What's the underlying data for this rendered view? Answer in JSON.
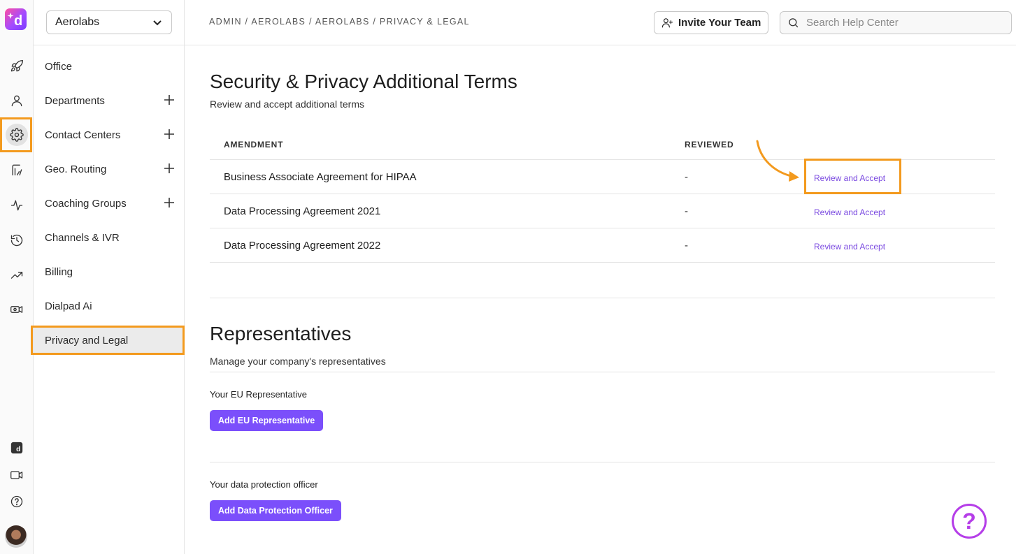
{
  "org_select": {
    "value": "Aerolabs"
  },
  "sidebar": {
    "items": [
      {
        "label": "Office",
        "has_plus": false
      },
      {
        "label": "Departments",
        "has_plus": true
      },
      {
        "label": "Contact Centers",
        "has_plus": true
      },
      {
        "label": "Geo. Routing",
        "has_plus": true
      },
      {
        "label": "Coaching Groups",
        "has_plus": true
      },
      {
        "label": "Channels & IVR",
        "has_plus": false
      },
      {
        "label": "Billing",
        "has_plus": false
      },
      {
        "label": "Dialpad Ai",
        "has_plus": false
      },
      {
        "label": "Privacy and Legal",
        "has_plus": false,
        "active": true
      }
    ]
  },
  "rail": {
    "icons": [
      "rocket-icon",
      "person-icon",
      "gear-icon",
      "routing-icon",
      "activity-icon",
      "history-icon",
      "trending-icon",
      "video-settings-icon",
      "dialpad-ai-icon",
      "video-icon",
      "help-icon"
    ],
    "active": "gear-icon"
  },
  "header": {
    "breadcrumb": "ADMIN / AEROLABS / AEROLABS / PRIVACY & LEGAL",
    "invite_label": "Invite Your Team",
    "search_placeholder": "Search Help Center"
  },
  "terms": {
    "title": "Security & Privacy Additional Terms",
    "subtitle": "Review and accept additional terms",
    "columns": [
      "AMENDMENT",
      "REVIEWED"
    ],
    "rows": [
      {
        "name": "Business Associate Agreement for HIPAA",
        "reviewed": "-",
        "action": "Review and Accept"
      },
      {
        "name": "Data Processing Agreement 2021",
        "reviewed": "-",
        "action": "Review and Accept"
      },
      {
        "name": "Data Processing Agreement 2022",
        "reviewed": "-",
        "action": "Review and Accept"
      }
    ]
  },
  "representatives": {
    "title": "Representatives",
    "subtitle": "Manage your company's representatives",
    "eu_label": "Your EU Representative",
    "eu_button": "Add EU Representative",
    "dpo_label": "Your data protection officer",
    "dpo_button": "Add Data Protection Officer"
  },
  "help_fab": {
    "glyph": "?"
  },
  "colors": {
    "accent": "#7b4ffb",
    "highlight": "#f39a1e",
    "link": "#7a49e0",
    "help": "#b53ee8"
  }
}
